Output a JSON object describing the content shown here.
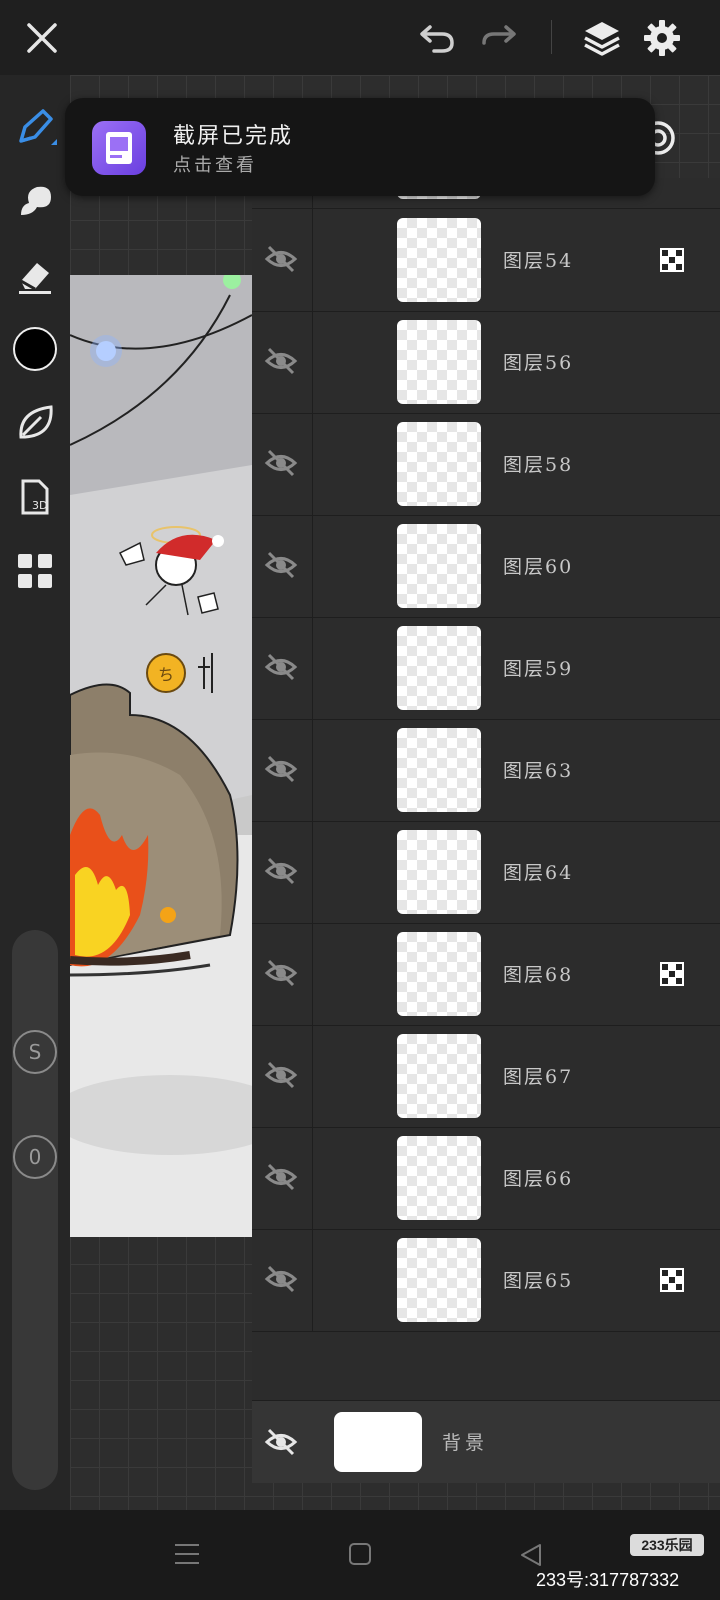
{
  "toast": {
    "title": "截屏已完成",
    "subtitle": "点击查看"
  },
  "layers": [
    {
      "name": "图层54",
      "alpha_lock": true
    },
    {
      "name": "图层56",
      "alpha_lock": false
    },
    {
      "name": "图层58",
      "alpha_lock": false
    },
    {
      "name": "图层60",
      "alpha_lock": false
    },
    {
      "name": "图层59",
      "alpha_lock": false
    },
    {
      "name": "图层63",
      "alpha_lock": false
    },
    {
      "name": "图层64",
      "alpha_lock": false
    },
    {
      "name": "图层68",
      "alpha_lock": true
    },
    {
      "name": "图层67",
      "alpha_lock": false
    },
    {
      "name": "图层66",
      "alpha_lock": false
    },
    {
      "name": "图层65",
      "alpha_lock": true
    }
  ],
  "background_layer": {
    "name": "背景"
  },
  "left_tools": {
    "color_swatch": "#000000",
    "s_button_label": "S",
    "o_button_label": "0"
  },
  "accent_color": "#3a8ee6",
  "watermark": {
    "badge": "233乐园",
    "id_text": "233号:317787332"
  }
}
